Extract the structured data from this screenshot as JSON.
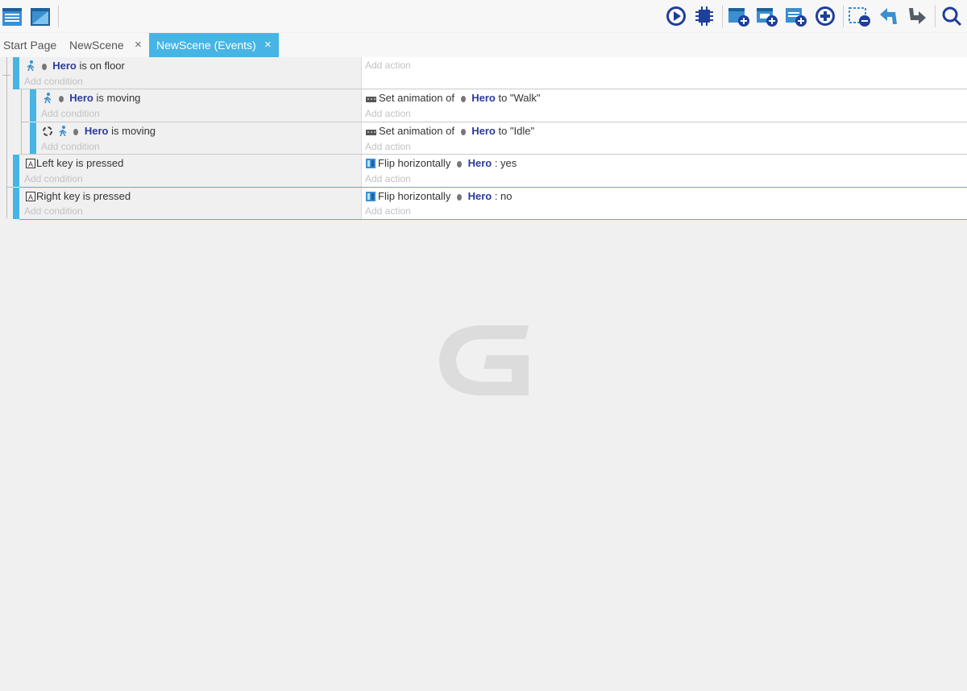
{
  "toolbar": {
    "left_icons": [
      "event-sheet-icon",
      "scene-icon"
    ],
    "right_icons": [
      "preview-play-icon",
      "debugger-chip-icon",
      "add-event-icon",
      "add-subevent-icon",
      "add-comment-icon",
      "add-more-icon",
      "delete-icon",
      "undo-icon",
      "redo-icon",
      "search-icon"
    ]
  },
  "tabs": [
    {
      "label": "Start Page",
      "closable": false,
      "active": false
    },
    {
      "label": "NewScene",
      "closable": true,
      "active": false
    },
    {
      "label": "NewScene (Events)",
      "closable": true,
      "active": true
    }
  ],
  "close_glyph": "×",
  "add_condition": "Add condition",
  "add_action": "Add action",
  "events": [
    {
      "condition": {
        "object": "Hero",
        "text": "is on floor"
      },
      "action": null
    },
    {
      "condition": {
        "object": "Hero",
        "text": "is moving"
      },
      "action": {
        "prefix": "Set animation of",
        "object": "Hero",
        "suffix": "to \"Walk\""
      }
    },
    {
      "condition": {
        "object": "Hero",
        "text": "is moving"
      },
      "action": {
        "prefix": "Set animation of",
        "object": "Hero",
        "suffix": "to \"Idle\""
      }
    },
    {
      "condition": {
        "text": "Left key is pressed"
      },
      "action": {
        "prefix": "Flip horizontally",
        "object": "Hero",
        "suffix": ": yes"
      }
    },
    {
      "condition": {
        "text": "Right key is pressed"
      },
      "action": {
        "prefix": "Flip horizontally",
        "object": "Hero",
        "suffix": ": no"
      }
    }
  ],
  "colors": {
    "accent": "#46b5e5",
    "object_name": "#2c3a9c",
    "placeholder": "#c2c2c2"
  }
}
